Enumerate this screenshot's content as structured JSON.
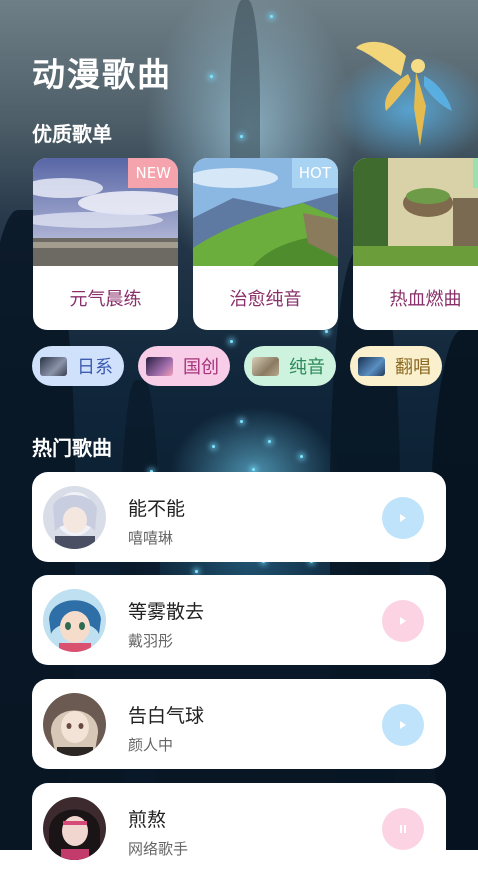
{
  "header": {
    "title": "动漫歌曲"
  },
  "sections": {
    "featured": "优质歌单",
    "hot": "热门歌曲"
  },
  "playlists": [
    {
      "label": "元气晨练",
      "badge": "NEW",
      "badge_color": "#f5a3ad"
    },
    {
      "label": "治愈纯音",
      "badge": "HOT",
      "badge_color": "#a9d3f2"
    },
    {
      "label": "热血燃曲",
      "badge": "U",
      "badge_color": "#9be0b0"
    }
  ],
  "categories": [
    {
      "label": "日系",
      "bg": "#cfe1fb",
      "color": "#3e5bb0"
    },
    {
      "label": "国创",
      "bg": "#f8cde7",
      "color": "#a6337a"
    },
    {
      "label": "纯音",
      "bg": "#cdf2de",
      "color": "#2c8a5a"
    },
    {
      "label": "翻唱",
      "bg": "#fbf0cd",
      "color": "#8a6a23"
    }
  ],
  "songs": [
    {
      "title": "能不能",
      "artist": "嘻嘻琳",
      "state": "play",
      "btn_color": "#bfe3fb"
    },
    {
      "title": "等雾散去",
      "artist": "戴羽彤",
      "state": "play",
      "btn_color": "#fbd3e3"
    },
    {
      "title": "告白气球",
      "artist": "颜人中",
      "state": "play",
      "btn_color": "#bfe3fb"
    },
    {
      "title": "煎熬",
      "artist": "网络歌手",
      "state": "pause",
      "btn_color": "#fbd3e3"
    }
  ],
  "icons": {
    "play": "play-icon",
    "pause": "pause-icon"
  }
}
